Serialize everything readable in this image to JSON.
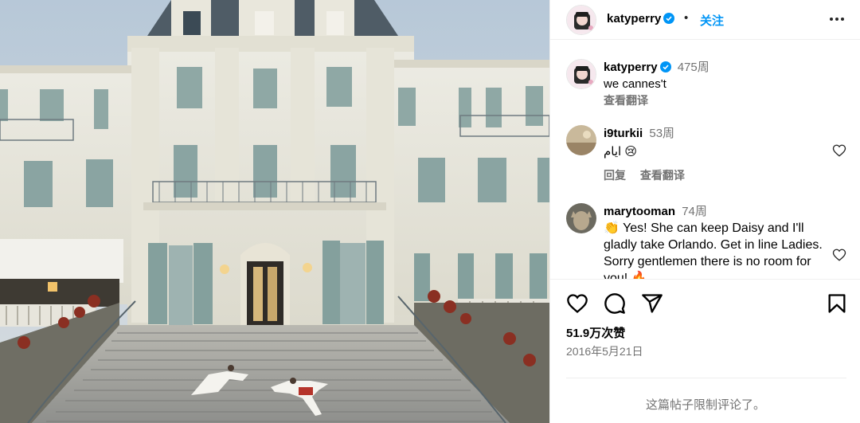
{
  "post": {
    "username": "katyperry",
    "dot": "•",
    "follow_label": "关注",
    "icons": {
      "more": "more-options-icon",
      "verified": "verified-badge-icon",
      "verified_color": "#0095f6",
      "follow_color": "#0095f6"
    }
  },
  "caption": {
    "username": "katyperry",
    "time": "475周",
    "text": "we cannes't",
    "translate": "查看翻译"
  },
  "comments": [
    {
      "username": "i9turkii",
      "time": "53周",
      "text": "ايام 😢",
      "reply": "回复",
      "translate": "查看翻译"
    },
    {
      "username": "marytooman",
      "time": "74周",
      "text": "👏 Yes! She can keep Daisy and I'll gladly take Orlando. Get in line Ladies. Sorry gentlemen there is no room for you! 🔥"
    }
  ],
  "actions": {
    "icons": [
      "like-heart-icon",
      "comment-icon",
      "share-icon",
      "save-bookmark-icon"
    ],
    "likes": "51.9万次赞",
    "date": "2016年5月21日"
  },
  "footer": {
    "limited_text": "这篇帖子限制评论了。"
  },
  "photo": {
    "subject": "post-photo"
  }
}
